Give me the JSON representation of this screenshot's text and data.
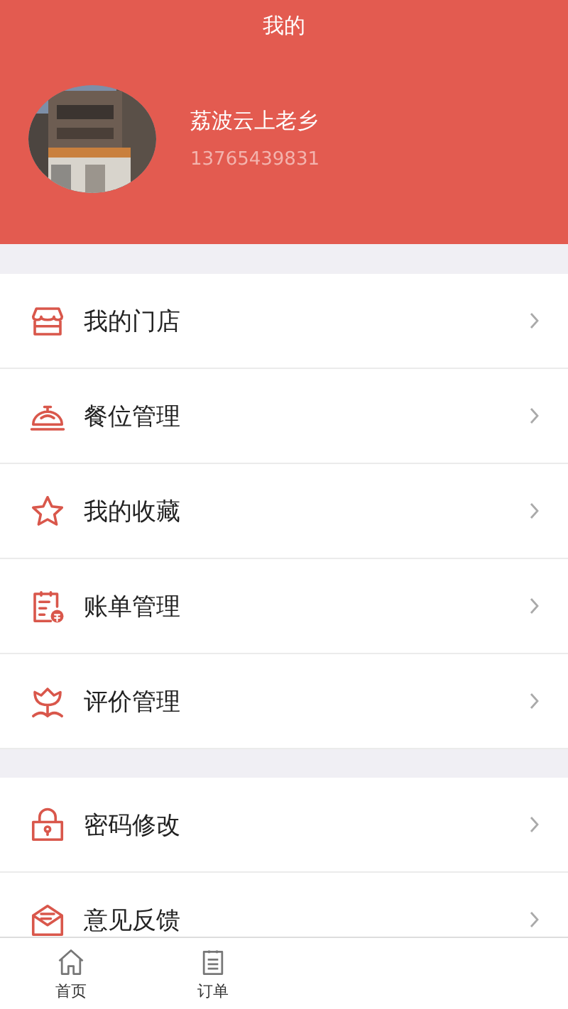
{
  "header": {
    "title": "我的",
    "profile": {
      "kind": "picture",
      "name": "荔波云上老乡",
      "phone": "13765439831"
    }
  },
  "menu_groups": [
    {
      "items": [
        {
          "kind": "store",
          "label": "我的门店"
        },
        {
          "kind": "cloche",
          "label": "餐位管理"
        },
        {
          "kind": "star",
          "label": "我的收藏"
        },
        {
          "kind": "bill",
          "label": "账单管理"
        },
        {
          "kind": "flower",
          "label": "评价管理"
        }
      ]
    },
    {
      "items": [
        {
          "kind": "lock",
          "label": "密码修改"
        },
        {
          "kind": "mail",
          "label": "意见反馈"
        }
      ]
    }
  ],
  "bottom_nav": [
    {
      "kind": "home",
      "label": "首页",
      "selected": false
    },
    {
      "kind": "list",
      "label": "订单",
      "selected": false
    }
  ]
}
